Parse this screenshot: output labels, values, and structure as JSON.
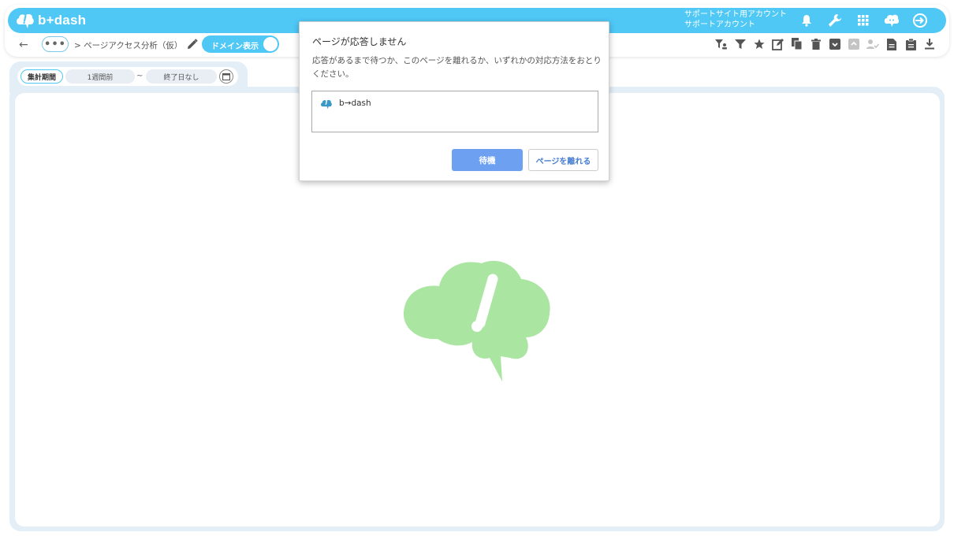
{
  "header": {
    "logo_text": "b+dash",
    "support_line1": "サポートサイト用アカウント",
    "support_line2": "サポートアカウント",
    "icons": [
      "bell-icon",
      "wrench-icon",
      "apps-grid-icon",
      "chat-icon",
      "logout-icon"
    ]
  },
  "nav": {
    "back_arrow": "←",
    "more_dots": "•••",
    "breadcrumb": "> ページアクセス分析（仮）",
    "domain_toggle_label": "ドメイン表示",
    "toolbar_icons": [
      "filter-person-icon",
      "filter-icon",
      "star-icon",
      "edit-note-icon",
      "copy-icon",
      "trash-icon",
      "archive-icon",
      "archive-disabled-icon",
      "user-check-icon",
      "document-icon",
      "clipboard-icon",
      "download-icon"
    ]
  },
  "date_filter": {
    "period_label": "集計期間",
    "start": "1週間前",
    "tilde": "~",
    "end": "終了日なし"
  },
  "dialog": {
    "title": "ページが応答しません",
    "message": "応答があるまで待つか、このページを離れるか、いずれかの対応方法をおとりください。",
    "page_item": "b→dash",
    "wait_button": "待機",
    "leave_button": "ページを離れる"
  },
  "colors": {
    "brand_blue": "#4fc8f5",
    "frame_bg": "#e3eef7",
    "cloud_green": "#abe5a2",
    "wait_button": "#6ea0f2"
  }
}
